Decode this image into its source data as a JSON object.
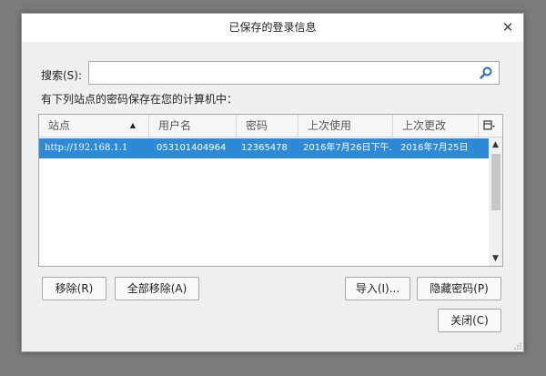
{
  "dialog": {
    "title": "已保存的登录信息",
    "close_glyph": "✕"
  },
  "search": {
    "label": "搜索(S):",
    "value": "",
    "placeholder": ""
  },
  "description": "有下列站点的密码保存在您的计算机中：",
  "table": {
    "columns": [
      "站点",
      "用户名",
      "密码",
      "上次使用",
      "上次更改"
    ],
    "sort_indicator": "▲",
    "rows": [
      {
        "site": "http://192.168.1.1",
        "username": "053101404964",
        "password": "12365478",
        "last_used": "2016年7月26日下午.",
        "last_changed": "2016年7月25日"
      }
    ],
    "scroll_up": "▲",
    "scroll_down": "▼"
  },
  "buttons": {
    "remove": "移除(R)",
    "remove_all": "全部移除(A)",
    "import": "导入(I)...",
    "hide_passwords": "隐藏密码(P)",
    "close": "关闭(C)"
  },
  "colors": {
    "selected_row": "#2d8ad7",
    "search_icon": "#2d6fb3"
  },
  "icons": {
    "search": "search-icon",
    "column_picker": "column-picker-icon",
    "close": "close-icon"
  }
}
